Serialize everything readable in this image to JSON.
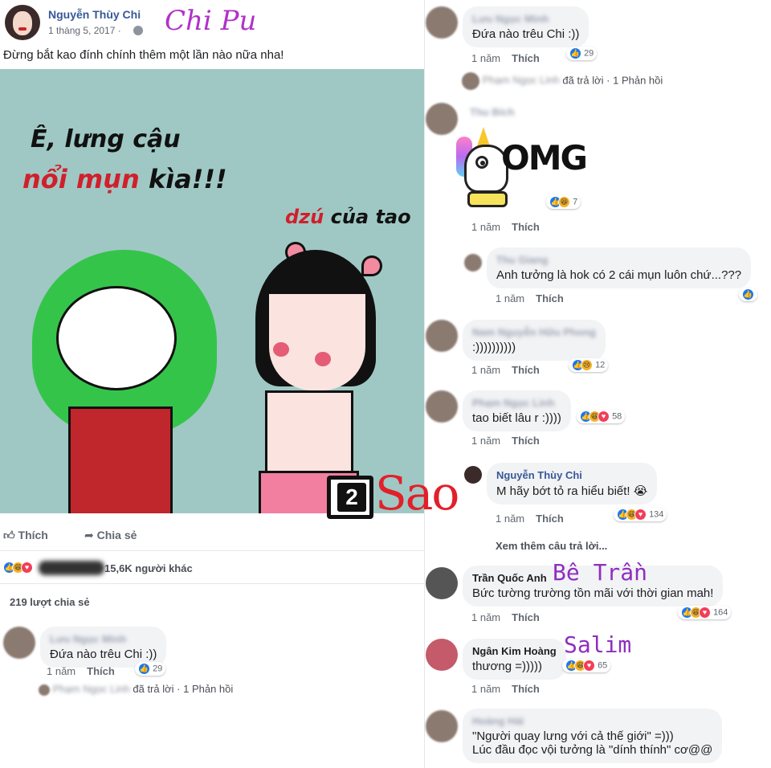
{
  "post": {
    "author": "Nguyễn Thùy Chi",
    "date": "1 tháng 5, 2017 ·",
    "tag_overlay": "Chi Pu",
    "text": "Đừng bắt kao đính chính thêm một lần nào nữa nha!",
    "image_caption_1": "Ê, lưng cậu",
    "image_caption_2_red": "nổi mụn",
    "image_caption_2_rest": " kìa!!!",
    "image_caption_3_red": "dzú",
    "image_caption_3_rest": " của tao",
    "like_label": "Thích",
    "share_label": "Chia sẻ",
    "reaction_summary": "15,6K người khác",
    "share_count": "219 lượt chia sẻ",
    "first_comment": {
      "name": "Lưu Ngọc Minh",
      "text": "Đứa nào trêu Chi :))",
      "time": "1 năm",
      "like": "Thích",
      "reactions": "29",
      "replied_name": "Phạm Ngọc Linh",
      "replied_text": "đã trả lời",
      "replies_link": "· 1 Phản hồi"
    }
  },
  "watermark": {
    "num": "2",
    "text": "Sao"
  },
  "omg_sticker": {
    "text": "OMG"
  },
  "comments": [
    {
      "name": "Lưu Ngọc Minh",
      "text": "Đứa nào trêu Chi :))",
      "time": "1 năm",
      "like": "Thích",
      "reactions": "29",
      "replied_name": "Phạm Ngọc Linh",
      "replied_text": "đã trả lời",
      "replies_link": "· 1 Phản hồi"
    },
    {
      "name": "Thu Bích",
      "time": "1 năm",
      "like": "Thích",
      "reactions": "7"
    },
    {
      "name": "Thu Giang",
      "text": "Anh tưởng là hok có 2 cái mụn luôn chứ...???",
      "time": "1 năm",
      "like": "Thích"
    },
    {
      "name": "Nam Nguyễn Hữu Phong",
      "text": ":))))))))))",
      "time": "1 năm",
      "like": "Thích",
      "reactions": "12"
    },
    {
      "name": "Phạm Ngọc Linh",
      "text": "tao biết lâu r :))))",
      "time": "1 năm",
      "like": "Thích",
      "reactions": "58"
    },
    {
      "name": "Nguyễn Thùy Chi",
      "text": "M hãy bớt tỏ ra hiểu biết! 😭",
      "time": "1 năm",
      "like": "Thích",
      "reactions": "134"
    },
    {
      "more": "Xem thêm câu trả lời..."
    },
    {
      "name": "Trần Quốc Anh",
      "text": "Bức tường trường tồn mãi với thời gian mah!",
      "time": "1 năm",
      "like": "Thích",
      "reactions": "164",
      "tag": "Bê Trần"
    },
    {
      "name": "Ngân Kim Hoàng",
      "text": "thương =)))))",
      "time": "1 năm",
      "like": "Thích",
      "reactions": "65",
      "tag": "Salim"
    },
    {
      "name": "Hoàng Hải",
      "text_line1": "\"Người quay lưng với cả thế giới\" =)))",
      "text_line2": "Lúc đầu đọc vội tưởng là \"dính thính\" cơ@@"
    }
  ],
  "colors": {
    "link_blue": "#385898",
    "bubble_bg": "#f2f3f5",
    "accent_purple": "#b031c9",
    "watermark_red": "#e2202a"
  }
}
